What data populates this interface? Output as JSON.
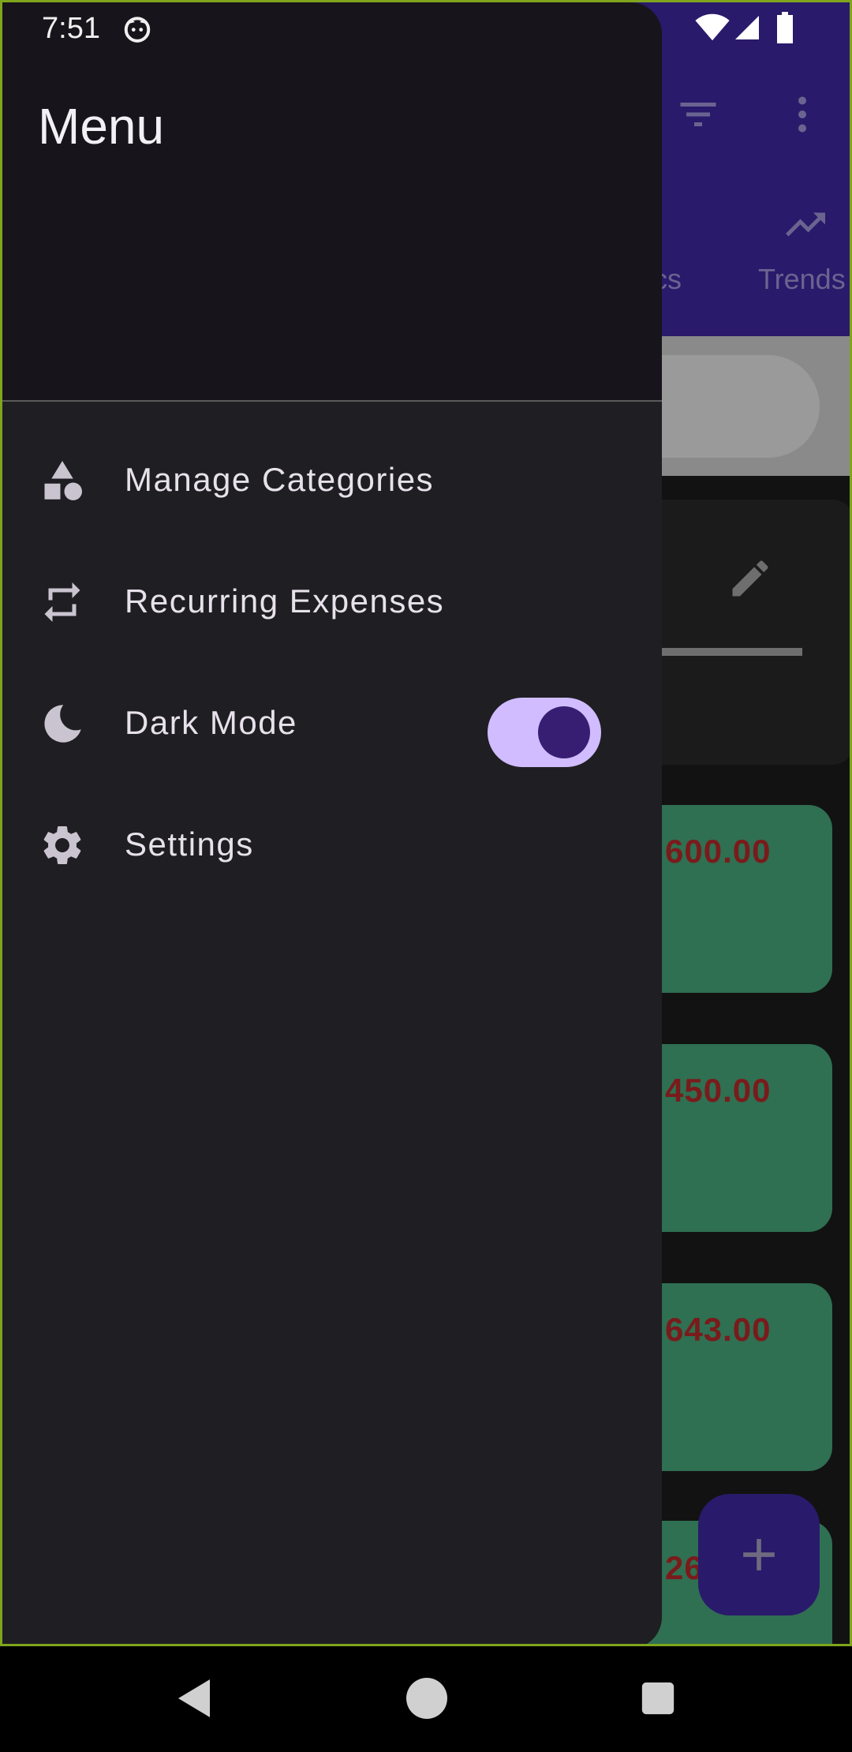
{
  "status_bar": {
    "time": "7:51"
  },
  "drawer": {
    "title": "Menu",
    "items": [
      {
        "label": "Manage Categories",
        "icon": "category-shapes-icon"
      },
      {
        "label": "Recurring Expenses",
        "icon": "repeat-icon"
      },
      {
        "label": "Dark Mode",
        "icon": "moon-icon",
        "toggle_on": true
      },
      {
        "label": "Settings",
        "icon": "gear-icon"
      }
    ]
  },
  "background": {
    "tabs": [
      "cs",
      "Trends"
    ],
    "expenses": [
      "600.00",
      "450.00",
      "643.00",
      "26"
    ]
  },
  "colors": {
    "accent": "#d0bcff",
    "accent_dark": "#381e72",
    "app_bar": "#2a1a6b",
    "drawer": "#1f1e22",
    "expense_card": "#2f6f52",
    "expense_amount": "#7a1b1b"
  }
}
